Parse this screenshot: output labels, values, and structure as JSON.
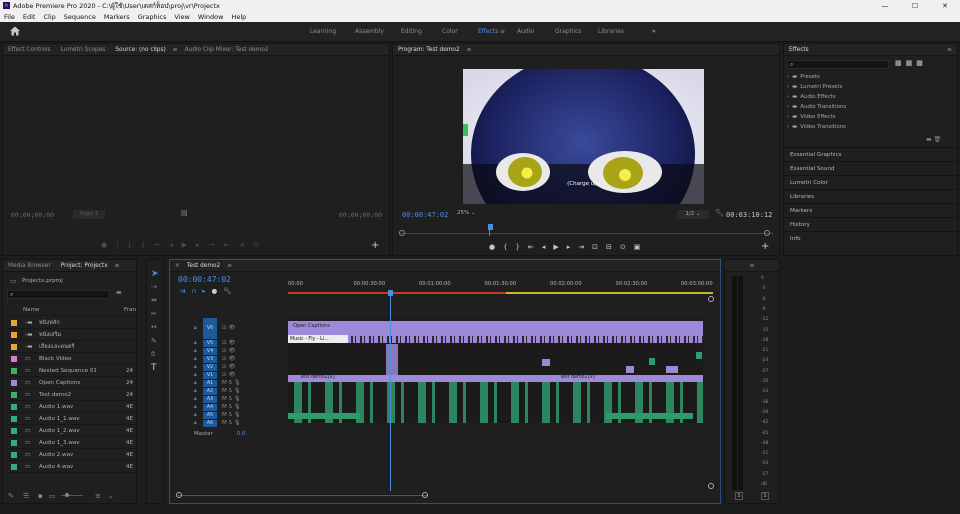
{
  "window": {
    "title": "Adobe Premiere Pro 2020 - C:\\ผู้ใช้\\User\\เดสก์ท็อป\\proj\\vr\\Projectx",
    "logo_text": "Pr",
    "min": "—",
    "max": "☐",
    "close": "✕"
  },
  "menu": [
    "File",
    "Edit",
    "Clip",
    "Sequence",
    "Markers",
    "Graphics",
    "View",
    "Window",
    "Help"
  ],
  "workspaces": {
    "home_icon": "home-icon",
    "items": [
      "Learning",
      "Assembly",
      "Editing",
      "Color",
      "Effects",
      "Audio",
      "Graphics",
      "Libraries"
    ],
    "active": "Effects",
    "more": "»"
  },
  "source_panel": {
    "tabs": [
      "Effect Controls",
      "Lumetri Scopes",
      "Source: (no clips)",
      "Audio Clip Mixer: Test demo2"
    ],
    "active_tab": "Source: (no clips)",
    "tc_left": "00;00;00;00",
    "page": "Page 1",
    "tc_right": "00;00;00;00"
  },
  "program_panel": {
    "title": "Program: Test demo2",
    "caption": "(Charge up)",
    "timecode": "00:00:47:02",
    "zoom": "25%",
    "fraction": "1/2",
    "duration": "00:03:10:12"
  },
  "effects_panel": {
    "title": "Effects",
    "folders": [
      "Presets",
      "Lumetri Presets",
      "Audio Effects",
      "Audio Transitions",
      "Video Effects",
      "Video Transitions"
    ],
    "sections": [
      "Essential Graphics",
      "Essential Sound",
      "Lumetri Color",
      "Libraries",
      "Markers",
      "History",
      "Info"
    ]
  },
  "project_panel": {
    "tabs": [
      "Media Browser",
      "Project: Projectx"
    ],
    "active_tab": "Project: Projectx",
    "file": "Projectx.prproj",
    "col_name": "Name",
    "col_frame": "Fran",
    "items": [
      {
        "name": "หนังหลัก",
        "color": "#e8a33a",
        "type": "folder",
        "rate": ""
      },
      {
        "name": "หนังเสริม",
        "color": "#e8a33a",
        "type": "folder",
        "rate": ""
      },
      {
        "name": "เสียงและดนตรี",
        "color": "#e8a33a",
        "type": "folder",
        "rate": ""
      },
      {
        "name": "Black Video",
        "color": "#d87ad0",
        "type": "item",
        "rate": ""
      },
      {
        "name": "Nested Sequence 01",
        "color": "#3bb06c",
        "type": "item",
        "rate": "24"
      },
      {
        "name": "Open Captions",
        "color": "#9e88d8",
        "type": "item",
        "rate": "24"
      },
      {
        "name": "Test demo2",
        "color": "#3bb06c",
        "type": "item",
        "rate": "24"
      },
      {
        "name": "Audio 1.wav",
        "color": "#2fae7a",
        "type": "item",
        "rate": "4E"
      },
      {
        "name": "Audio 1_1.wav",
        "color": "#2fae7a",
        "type": "item",
        "rate": "4E"
      },
      {
        "name": "Audio 1_2.wav",
        "color": "#2fae7a",
        "type": "item",
        "rate": "4E"
      },
      {
        "name": "Audio 1_3.wav",
        "color": "#2fae7a",
        "type": "item",
        "rate": "4E"
      },
      {
        "name": "Audio 2.wav",
        "color": "#2fae7a",
        "type": "item",
        "rate": "4E"
      },
      {
        "name": "Audio 4.wav",
        "color": "#2fae7a",
        "type": "item",
        "rate": "4E"
      }
    ]
  },
  "timeline": {
    "tab": "Test demo2",
    "timecode": "00:00:47:02",
    "ruler": [
      "00:00",
      "00:00:30:00",
      "00:01:00:00",
      "00:01:30:00",
      "00:02:00:00",
      "00:02:30:00",
      "00:03:00:00"
    ],
    "video_tracks": [
      "V6",
      "V5",
      "V4",
      "V3",
      "V2",
      "V1"
    ],
    "audio_tracks": [
      "A1",
      "A2",
      "A3",
      "A4",
      "A5",
      "A6"
    ],
    "master": "Master",
    "master_value": "0.0",
    "clip_open_captions": "Open Captions",
    "clip_music": "Music - Fly - Li...",
    "clip_test1": "Test demo2[V]",
    "clip_test2": "Test demo2[V]"
  },
  "meter": {
    "scale": [
      "0",
      "-3",
      "-6",
      "-9",
      "-12",
      "-15",
      "-18",
      "-21",
      "-24",
      "-27",
      "-30",
      "-33",
      "-36",
      "-39",
      "-42",
      "-45",
      "-48",
      "-51",
      "-54",
      "-57",
      "dB"
    ],
    "solo_l": "S",
    "solo_r": "S"
  },
  "colors": {
    "accent": "#4c8fe0",
    "purple_clip": "#9e88d8",
    "green_clip": "#2f9a6c",
    "playhead": "#4c8fe0"
  }
}
